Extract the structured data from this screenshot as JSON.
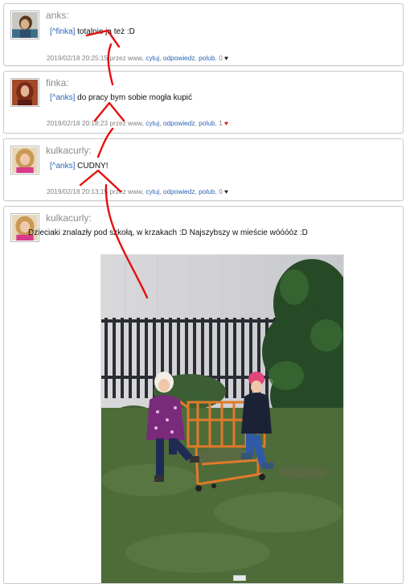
{
  "comments": [
    {
      "author": "anks:",
      "reply_to": "[^finka]",
      "text": " totalnie ja też :D",
      "meta": {
        "timestamp": "2019/02/18 20:25:15",
        "via": "przez www,",
        "quote": "cytuj",
        "reply": "odpowiedz",
        "like": "polub",
        "like_count": "0",
        "heart": "♥"
      }
    },
    {
      "author": "finka:",
      "reply_to": "[^anks]",
      "text": " do pracy bym sobie mogła kupić",
      "meta": {
        "timestamp": "2019/02/18 20:18:23",
        "via": "przez www,",
        "quote": "cytuj",
        "reply": "odpowiedz",
        "like": "polub",
        "like_count": "1",
        "heart": "♥"
      }
    },
    {
      "author": "kulkacurly:",
      "reply_to": "[^anks]",
      "text": " CUDNY!",
      "meta": {
        "timestamp": "2019/02/18 20:13:15",
        "via": "przez www,",
        "quote": "cytuj",
        "reply": "odpowiedz",
        "like": "polub",
        "like_count": "0",
        "heart": "♥"
      }
    },
    {
      "author": "kulkacurly:",
      "text": "Dzieciaki znalazły pod szkołą, w krzakach :D Najszybszy w mieście wóóóóz :D"
    }
  ],
  "colors": {
    "link": "#2a64b5",
    "meta": "#808080",
    "author": "#8a8a8a",
    "like_heart_active": "#d21a1a",
    "annotation": "#e31010"
  }
}
